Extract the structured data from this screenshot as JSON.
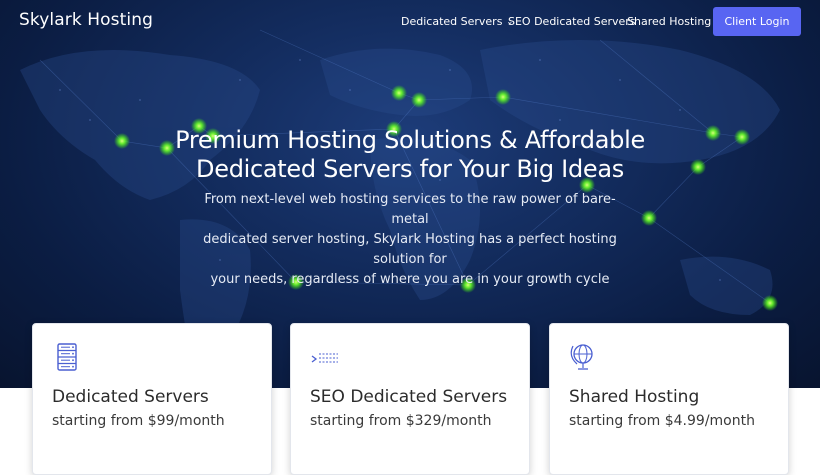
{
  "brand": "Skylark Hosting",
  "nav": {
    "items": [
      {
        "label": "Dedicated Servers",
        "has_dropdown": true
      },
      {
        "label": "SEO Dedicated Servers"
      },
      {
        "label": "Shared Hosting"
      }
    ],
    "cta_label": "Client Login"
  },
  "hero": {
    "title_line1": "Premium Hosting Solutions & Affordable",
    "title_line2": "Dedicated Servers for Your Big Ideas",
    "subtitle_line1": "From next-level web hosting services to the raw power of bare-metal",
    "subtitle_line2": "dedicated server hosting, Skylark Hosting has a perfect hosting solution for",
    "subtitle_line3": "your needs, regardless of where you are in your growth cycle"
  },
  "cards": [
    {
      "title": "Dedicated Servers",
      "price": "starting from $99/month",
      "icon": "server-rack-icon"
    },
    {
      "title": "SEO Dedicated Servers",
      "price": "starting from $329/month",
      "icon": "seo-chart-icon"
    },
    {
      "title": "Shared Hosting",
      "price": "starting from $4.99/month",
      "icon": "globe-icon"
    }
  ],
  "colors": {
    "hero_bg": "#132c5e",
    "accent": "#5865f2",
    "icon_blue": "#4a5fd1",
    "node_green": "#7dff3a"
  }
}
